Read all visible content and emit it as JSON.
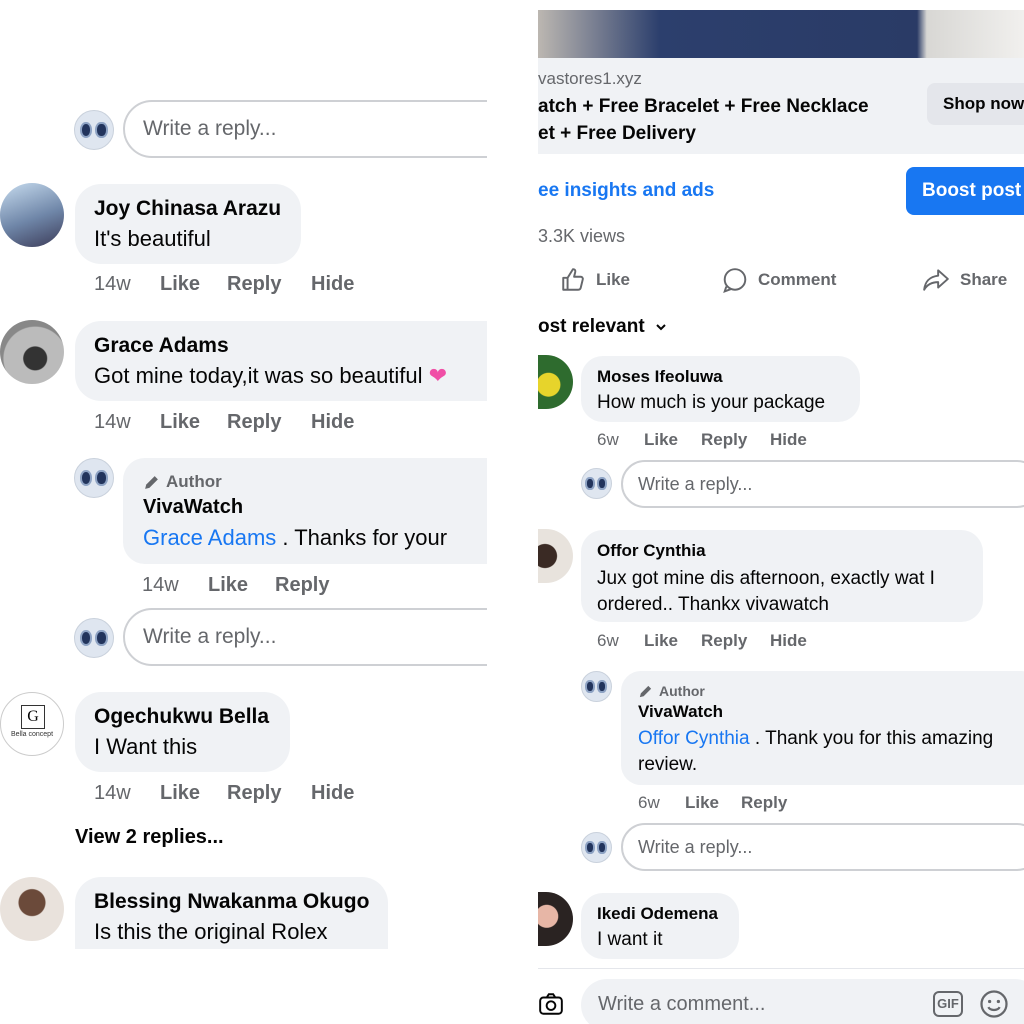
{
  "left": {
    "reply_placeholder": "Write a reply...",
    "comments": [
      {
        "name": "Joy Chinasa Arazu",
        "text": "It's beautiful",
        "time": "14w",
        "like": "Like",
        "reply": "Reply",
        "hide": "Hide"
      },
      {
        "name": "Grace Adams",
        "text": "Got mine today,it was so beautiful",
        "time": "14w",
        "like": "Like",
        "reply": "Reply",
        "hide": "Hide",
        "author_reply": {
          "tag": "Author",
          "name": "VivaWatch",
          "mention": "Grace Adams",
          "text": ". Thanks for your",
          "time": "14w",
          "like": "Like",
          "reply": "Reply"
        }
      },
      {
        "name": "Ogechukwu Bella",
        "text": "I Want this",
        "time": "14w",
        "like": "Like",
        "reply": "Reply",
        "hide": "Hide",
        "view_replies": "View 2 replies...",
        "avatar_text": "Bella concept"
      },
      {
        "name": "Blessing Nwakanma Okugo",
        "text": "Is this the original Rolex"
      }
    ]
  },
  "right": {
    "link": {
      "domain": "vastores1.xyz",
      "line1": "atch + Free Bracelet + Free Necklace",
      "line2": "et + Free Delivery",
      "cta": "Shop now"
    },
    "insights": "ee insights and ads",
    "boost": "Boost post",
    "views": "3.3K views",
    "actions": {
      "like": "Like",
      "comment": "Comment",
      "share": "Share"
    },
    "sort": "ost relevant",
    "reply_placeholder": "Write a reply...",
    "comments": [
      {
        "name": "Moses Ifeoluwa",
        "text": "How much is your package",
        "time": "6w",
        "like": "Like",
        "reply": "Reply",
        "hide": "Hide"
      },
      {
        "name": "Offor Cynthia",
        "text1": "Jux got mine dis afternoon, exactly wat I",
        "text2": "ordered.. Thankx vivawatch",
        "time": "6w",
        "like": "Like",
        "reply": "Reply",
        "hide": "Hide",
        "author_reply": {
          "tag": "Author",
          "name": "VivaWatch",
          "mention": "Offor Cynthia",
          "text1": ". Thank you for this amazing",
          "text2": "review.",
          "time": "6w",
          "like": "Like",
          "reply": "Reply"
        }
      },
      {
        "name": "Ikedi Odemena",
        "text": "I want it"
      }
    ],
    "comment_placeholder": "Write a comment...",
    "gif_label": "GIF"
  }
}
